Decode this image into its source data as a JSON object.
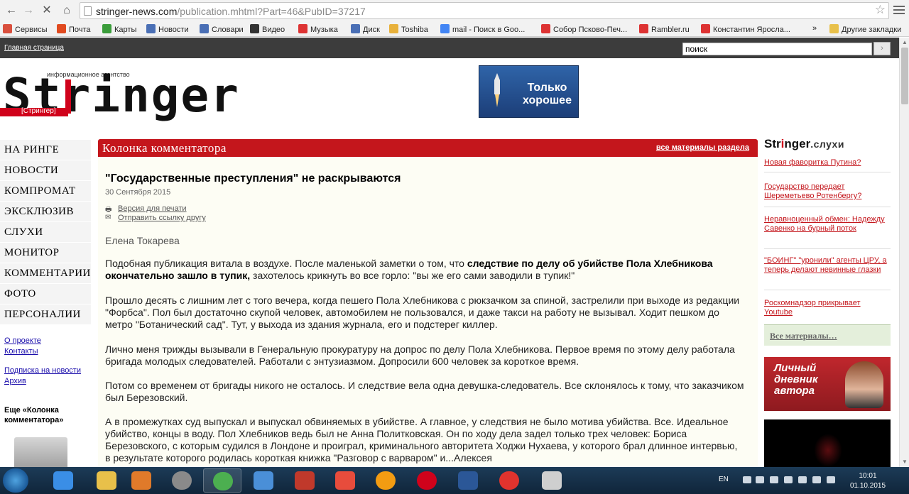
{
  "browser": {
    "url_host": "stringer-news.com",
    "url_path": "/publication.mhtml?Part=46&PubID=37217",
    "bookmarks": [
      {
        "label": "Сервисы",
        "color": "#d94f3d"
      },
      {
        "label": "Почта",
        "color": "#e04a1f"
      },
      {
        "label": "Карты",
        "color": "#3b9d3b"
      },
      {
        "label": "Новости",
        "color": "#4a6fb5"
      },
      {
        "label": "Словари",
        "color": "#4a6fb5"
      },
      {
        "label": "Видео",
        "color": "#333333"
      },
      {
        "label": "Музыка",
        "color": "#d33"
      },
      {
        "label": "Диск",
        "color": "#4a6fb5"
      },
      {
        "label": "Toshiba",
        "color": "#e8b13b"
      },
      {
        "label": "mail - Поиск в Goo...",
        "color": "#4285f4"
      },
      {
        "label": "Собор Псково-Печ...",
        "color": "#d33"
      },
      {
        "label": "Rambler.ru",
        "color": "#d33"
      },
      {
        "label": "Константин Яросла...",
        "color": "#d33"
      }
    ],
    "bookmarks_more": "»",
    "other_bookmarks": "Другие закладки"
  },
  "site": {
    "home_link": "Главная страница",
    "search_placeholder": "поиск",
    "search_go": "›",
    "logo_word": "Stringer",
    "logo_subtitle": "информационное агентство",
    "logo_red_label": "[Стрингер]",
    "banner_text": "Только хорошее"
  },
  "left_nav": {
    "items": [
      "НА РИНГЕ",
      "НОВОСТИ",
      "КОМПРОМАТ",
      "ЭКСКЛЮЗИВ",
      "СЛУХИ",
      "МОНИТОР",
      "КОММЕНТАРИИ",
      "ФОТО",
      "ПЕРСОНАЛИИ"
    ],
    "links": [
      "О проекте",
      "Контакты",
      "Подписка на новости",
      "Архив"
    ],
    "more_title": "Еще «Колонка комментатора»"
  },
  "main": {
    "section_title": "Колонка комментатора",
    "section_link": "все материалы раздела",
    "title": "\"Государственные преступления\" не раскрываются",
    "date": "30 Сентября 2015",
    "print_link": "Версия для печати",
    "send_link": "Отправить ссылку другу",
    "author": "Елена Токарева",
    "p1_a": "Подобная публикация витала в воздухе. После маленькой заметки о том, что ",
    "p1_b": "следствие по делу об убийстве Пола Хлебникова окончательно зашло в тупик,",
    "p1_c": " захотелось крикнуть во все горло: \"вы же его сами заводили в тупик!\"",
    "p2": "Прошло десять с лишним лет с того вечера, когда пешего Пола Хлебникова с рюкзачком за спиной, застрелили при выходе из редакции \"Форбса\". Пол был достаточно скупой человек, автомобилем не пользовался, и даже такси на работу не вызывал. Ходит пешком до метро \"Ботанический сад\". Тут, у выхода из здания журнала, его и подстерег киллер.",
    "p3": "Лично меня трижды вызывали в Генеральную прокуратуру на допрос по делу Пола Хлебникова. Первое время по этому делу работала бригада молодых следователей. Работали с энтузиазмом. Допросили 600 человек за короткое время.",
    "p4": "Потом со временем от бригады никого не осталось. И следствие вела одна девушка-следователь. Все склонялось к тому, что заказчиком был Березовский.",
    "p5": "А в промежутках суд выпускал и выпускал обвиняемых в убийстве. А главное, у следствия не было мотива убийства. Все. Идеальное убийство, концы в воду. Пол Хлебников ведь был не Анна Политковская. Он по ходу дела задел только трех человек: Бориса Березовского, с которым судился в Лондоне и проиграл, криминального авторитета Ходжи Нухаева, у которого брал длинное интервью, в результате которого родилась короткая книжка \"Разговор с варваром\" и...Алексея"
  },
  "right": {
    "logo_a": "Str",
    "logo_b": "i",
    "logo_c": "nger",
    "logo_suffix": ".слухи",
    "items": [
      "Новая фаворитка Путина?",
      "Государство передает Шереметьево Ротенбергу?",
      "Неравноценный обмен: Надежду Савенко на бурный поток",
      "\"БОИНГ\" \"уронили\" агенты ЦРУ, а теперь делают невинные глазки",
      "Роскомнадзор прикрывает Youtube"
    ],
    "all_materials": "Все материалы…",
    "diary_text": "Личный дневник автора"
  },
  "taskbar": {
    "lang": "EN",
    "time": "10:01",
    "date": "01.10.2015",
    "apps": [
      {
        "name": "ie",
        "color": "#3a8ee6"
      },
      {
        "name": "explorer",
        "color": "#e8c04a"
      },
      {
        "name": "media",
        "color": "#e07a2a"
      },
      {
        "name": "disc",
        "color": "#8a8a8a"
      },
      {
        "name": "chrome",
        "color": "#4caf50"
      },
      {
        "name": "mail",
        "color": "#4a8fd8"
      },
      {
        "name": "kaspersky",
        "color": "#c0392b"
      },
      {
        "name": "yandex",
        "color": "#e74c3c"
      },
      {
        "name": "orange",
        "color": "#f39c12"
      },
      {
        "name": "opera",
        "color": "#d0021b"
      },
      {
        "name": "word",
        "color": "#2b5797"
      },
      {
        "name": "yandex-browser",
        "color": "#e0332e"
      },
      {
        "name": "paint",
        "color": "#cfcfcf"
      }
    ]
  }
}
